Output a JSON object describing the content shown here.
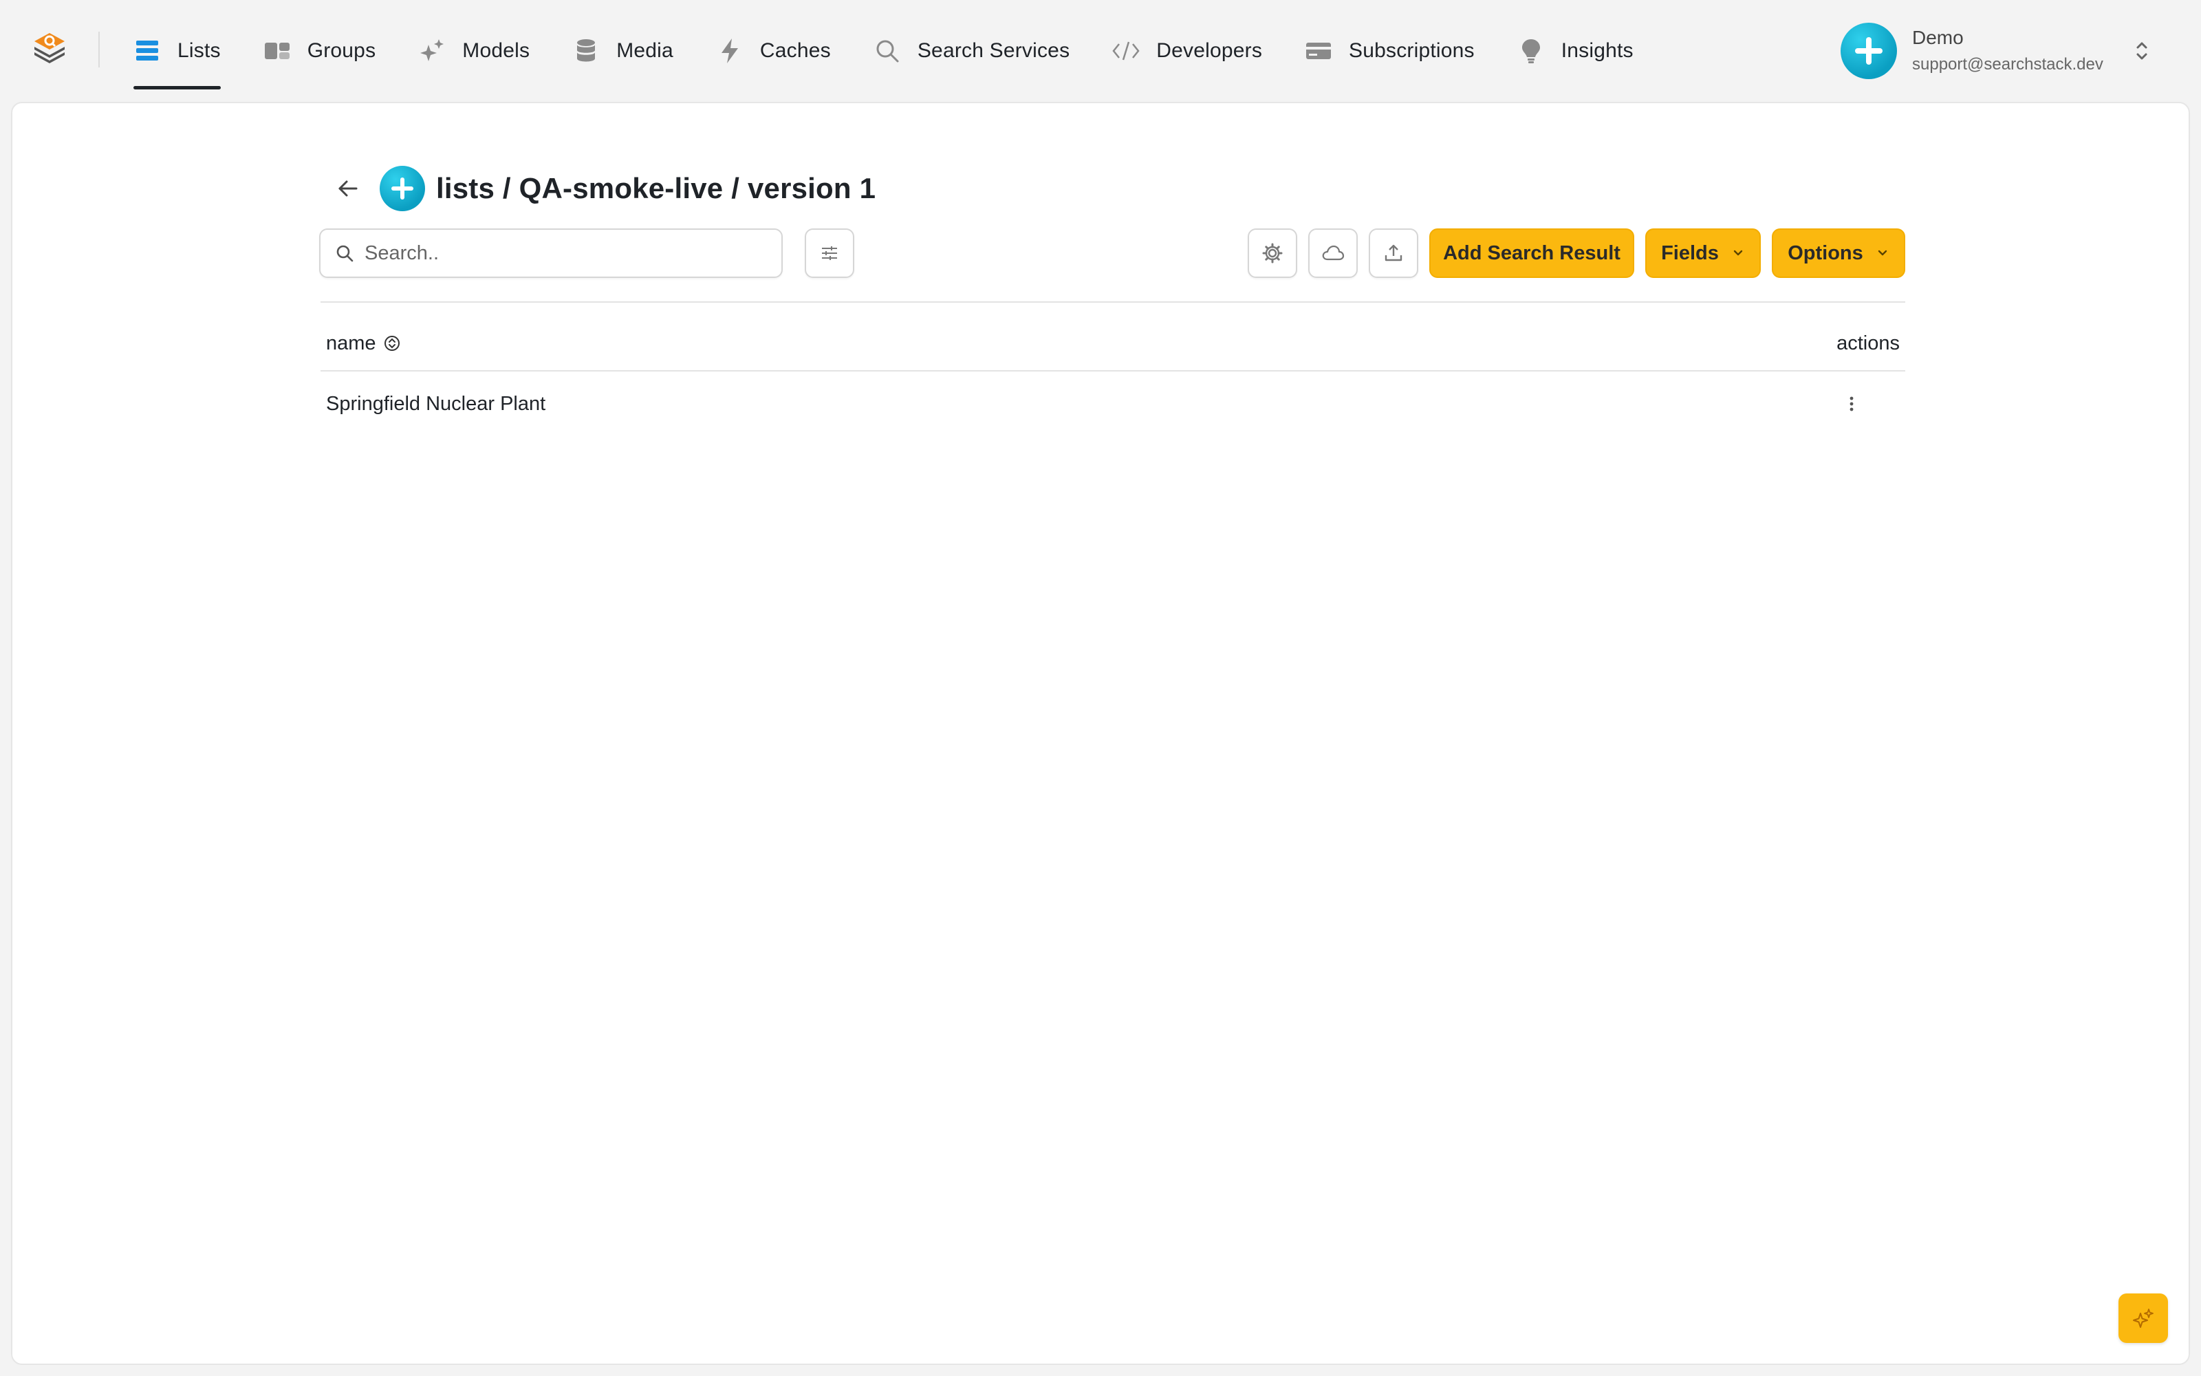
{
  "nav": {
    "items": [
      {
        "label": "Lists",
        "icon": "lists-icon",
        "active": true
      },
      {
        "label": "Groups",
        "icon": "groups-icon",
        "active": false
      },
      {
        "label": "Models",
        "icon": "sparkles-icon",
        "active": false
      },
      {
        "label": "Media",
        "icon": "database-icon",
        "active": false
      },
      {
        "label": "Caches",
        "icon": "bolt-icon",
        "active": false
      },
      {
        "label": "Search Services",
        "icon": "search-icon",
        "active": false
      },
      {
        "label": "Developers",
        "icon": "code-icon",
        "active": false
      },
      {
        "label": "Subscriptions",
        "icon": "credit-card-icon",
        "active": false
      },
      {
        "label": "Insights",
        "icon": "lightbulb-icon",
        "active": false
      }
    ]
  },
  "account": {
    "name": "Demo",
    "email": "support@searchstack.dev"
  },
  "page": {
    "title": "lists / QA-smoke-live / version 1"
  },
  "toolbar": {
    "search_placeholder": "Search..",
    "add_label": "Add Search Result",
    "fields_label": "Fields",
    "options_label": "Options"
  },
  "table": {
    "columns": {
      "name": "name",
      "actions": "actions"
    },
    "rows": [
      {
        "name": "Springfield Nuclear Plant"
      }
    ]
  },
  "colors": {
    "accent": "#fbb80f",
    "avatar": "#0b9fc2",
    "nav_active_icon": "#1a8fe0"
  }
}
